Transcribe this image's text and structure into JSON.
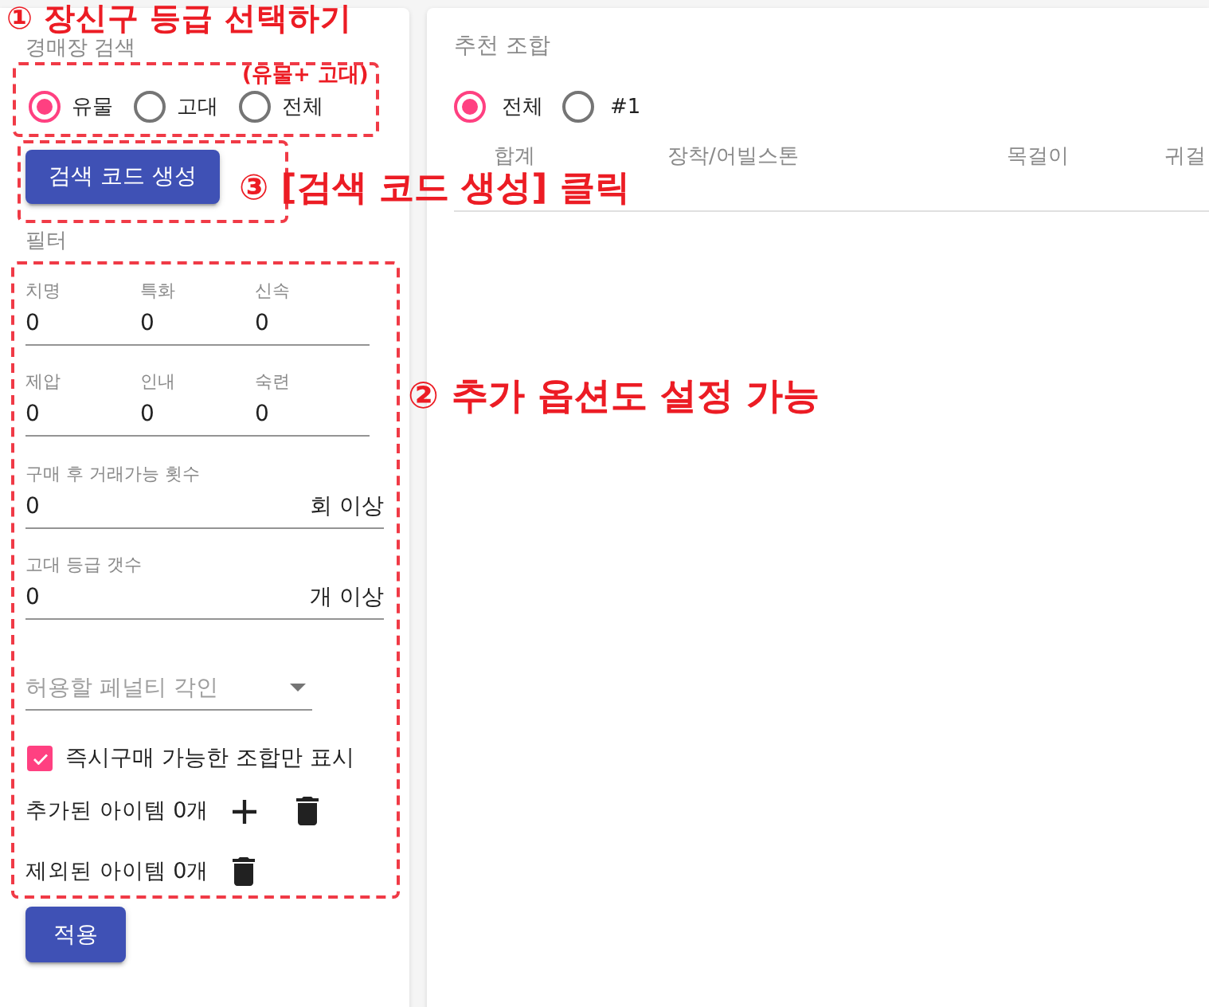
{
  "search_panel": {
    "callout": "① 장신구 등급 선택하기",
    "title": "경매장 검색",
    "grade_note": "(유물+ 고대)",
    "grades": [
      {
        "label": "유물",
        "selected": true
      },
      {
        "label": "고대",
        "selected": false
      },
      {
        "label": "전체",
        "selected": false
      }
    ],
    "generate_button": "검색 코드 생성",
    "button_callout": "③ [검색 코드 생성] 클릭"
  },
  "filter": {
    "title": "필터",
    "callout": "② 추가 옵션도 설정 가능",
    "stats": [
      {
        "label": "치명",
        "value": "0"
      },
      {
        "label": "특화",
        "value": "0"
      },
      {
        "label": "신속",
        "value": "0"
      },
      {
        "label": "제압",
        "value": "0"
      },
      {
        "label": "인내",
        "value": "0"
      },
      {
        "label": "숙련",
        "value": "0"
      }
    ],
    "fields": [
      {
        "label": "구매 후 거래가능 횟수",
        "value": "0",
        "suffix": "회 이상"
      },
      {
        "label": "고대 등급 갯수",
        "value": "0",
        "suffix": "개 이상"
      }
    ],
    "penalty_select": {
      "placeholder": "허용할 페널티 각인"
    },
    "instant_buy": {
      "label": "즉시구매 가능한 조합만 표시",
      "checked": true
    },
    "added_items": "추가된 아이템 0개",
    "excluded_items": "제외된 아이템 0개"
  },
  "apply_button": "적용",
  "results": {
    "title": "추천 조합",
    "tabs": [
      {
        "label": "전체",
        "selected": true
      },
      {
        "label": "#1",
        "selected": false
      }
    ],
    "columns": [
      "합계",
      "장착/어빌스톤",
      "목걸이",
      "귀걸"
    ]
  }
}
